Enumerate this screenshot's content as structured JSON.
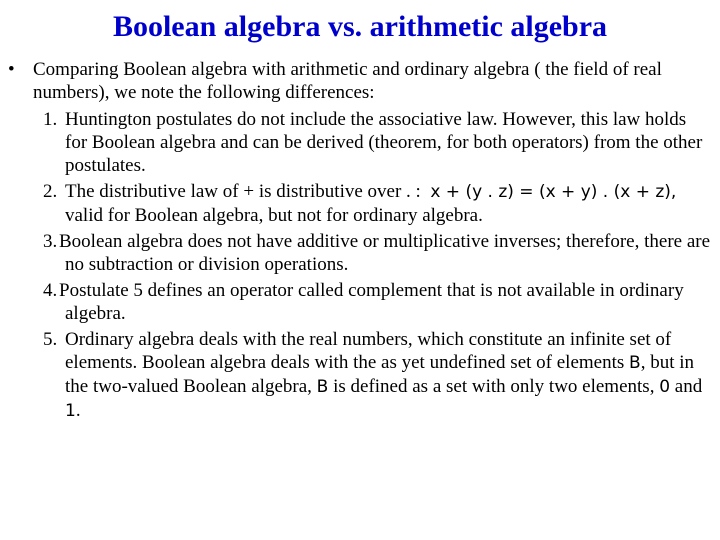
{
  "slide": {
    "title": "Boolean algebra vs. arithmetic algebra",
    "title_color": "#0000cc",
    "bullet": {
      "marker": "•",
      "text": "Comparing Boolean algebra with arithmetic and ordinary algebra ( the field of real numbers), we note the following differences:"
    },
    "items": [
      {
        "number": "1.",
        "text": "Huntington postulates do not include the associative law. However, this law holds for Boolean algebra and can be derived (theorem, for both operators) from the other postulates."
      },
      {
        "number": "2.",
        "text_before": "The distributive law of + is distributive over . :",
        "formula": "x + (y . z) = (x + y) . (x + z),",
        "text_after": "valid for Boolean algebra, but not for ordinary algebra."
      },
      {
        "number": "3.",
        "text": "Boolean algebra does not have additive or multiplicative inverses; therefore, there are no subtraction or division operations."
      },
      {
        "number": "4.",
        "text": "Postulate 5 defines an operator called complement that is not available in ordinary algebra."
      },
      {
        "number": "5.",
        "text_1": "Ordinary algebra deals with the real numbers, which constitute an infinite set of elements. Boolean algebra deals with the as yet undefined set of elements",
        "symbol_B": "B",
        "text_2": ", but in the two-valued Boolean algebra,",
        "symbol_B2": "B",
        "text_3": "is defined as a set with only two elements,",
        "symbol_0": "0",
        "text_4": "and",
        "symbol_1": "1",
        "text_5": "."
      }
    ]
  }
}
